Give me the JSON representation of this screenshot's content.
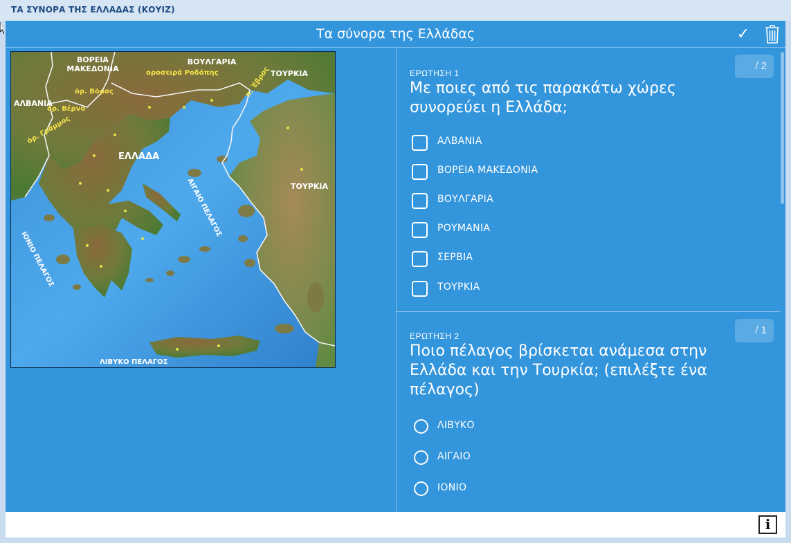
{
  "window": {
    "title": "ΤΑ ΣΥΝΟΡΑ ΤΗΣ ΕΛΛΑΔΑΣ (ΚΟΥΙΖ)"
  },
  "header": {
    "title": "Τα σύνορα της Ελλάδας",
    "check_icon": "✓"
  },
  "map": {
    "labels": {
      "north_macedonia": [
        "ΒΟΡΕΙΑ",
        "ΜΑΚΕΔΟΝΙΑ"
      ],
      "bulgaria": "ΒΟΥΛΓΑΡΙΑ",
      "turkey_ne": "ΤΟΥΡΚΙΑ",
      "albania": "ΑΛΒΑΝΙΑ",
      "rhodope": "οροσειρά Ροδόπης",
      "voras": "όρ. Βόρας",
      "verno": "όρ. Βέρνο",
      "evros": "π. Έβρος",
      "grammos": "όρ. Γράμμος",
      "greece": "ΕΛΛΑΔΑ",
      "aegean": "ΑΙΓΑΙΟ ΠΕΛΑΓΟΣ",
      "turkey_e": "ΤΟΥΡΚΙΑ",
      "ionian": "ΙΟΝΙΟ ΠΕΛΑΓΟΣ",
      "libyan": "ΛΙΒΥΚΟ ΠΕΛΑΓΟΣ"
    }
  },
  "questions": [
    {
      "number_label": "ΕΡΩΤΗΣΗ 1",
      "text": "Με ποιες από τις παρακάτω χώρες συνορεύει η Ελλάδα;",
      "score": "/ 2",
      "options": [
        "ΑΛΒΑΝΙΑ",
        "ΒΟΡΕΙΑ ΜΑΚΕΔΟΝΙΑ",
        "ΒΟΥΛΓΑΡΙΑ",
        "ΡΟΥΜΑΝΙΑ",
        "ΣΕΡΒΙΑ",
        "ΤΟΥΡΚΙΑ"
      ]
    },
    {
      "number_label": "ΕΡΩΤΗΣΗ 2",
      "text": "Ποιο πέλαγος βρίσκεται ανάμεσα στην Ελλάδα και την Τουρκία; (επιλέξτε ένα πέλαγος)",
      "score": "/ 1",
      "options": [
        "ΛΙΒΥΚΟ",
        "ΑΙΓΑΙΟ",
        "ΙΟΝΙΟ"
      ]
    }
  ],
  "footer": {
    "info_icon": "i"
  }
}
